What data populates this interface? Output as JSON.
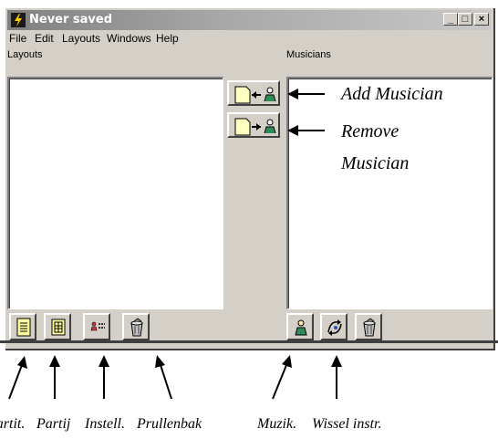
{
  "window": {
    "title": "Never saved",
    "controls": {
      "minimize": "_",
      "maximize": "□",
      "close": "×"
    }
  },
  "menu": [
    "File",
    "Edit",
    "Layouts",
    "Windows",
    "Help"
  ],
  "panels": {
    "layouts_label": "Layouts",
    "musicians_label": "Musicians"
  },
  "annotations": {
    "add_musician": "Add Musician",
    "remove_musician_1": "Remove",
    "remove_musician_2": "Musician",
    "bottom": [
      "Partit.",
      "Partij",
      "Instell.",
      "Prullenbak",
      "Muzik.",
      "Wissel instr."
    ]
  },
  "icons": {
    "add_musician": "page-arrow-left-person-icon",
    "remove_musician": "page-arrow-right-person-icon",
    "score": "score-page-icon",
    "part": "part-page-icon",
    "settings": "settings-list-icon",
    "trash_left": "trash-can-icon",
    "musician": "person-icon",
    "swap_instrument": "swap-instrument-icon",
    "trash_right": "trash-can-icon"
  },
  "colors": {
    "face": "#d4d0c8",
    "title_gradient_start": "#808080",
    "title_gradient_end": "#c8c8c8"
  }
}
